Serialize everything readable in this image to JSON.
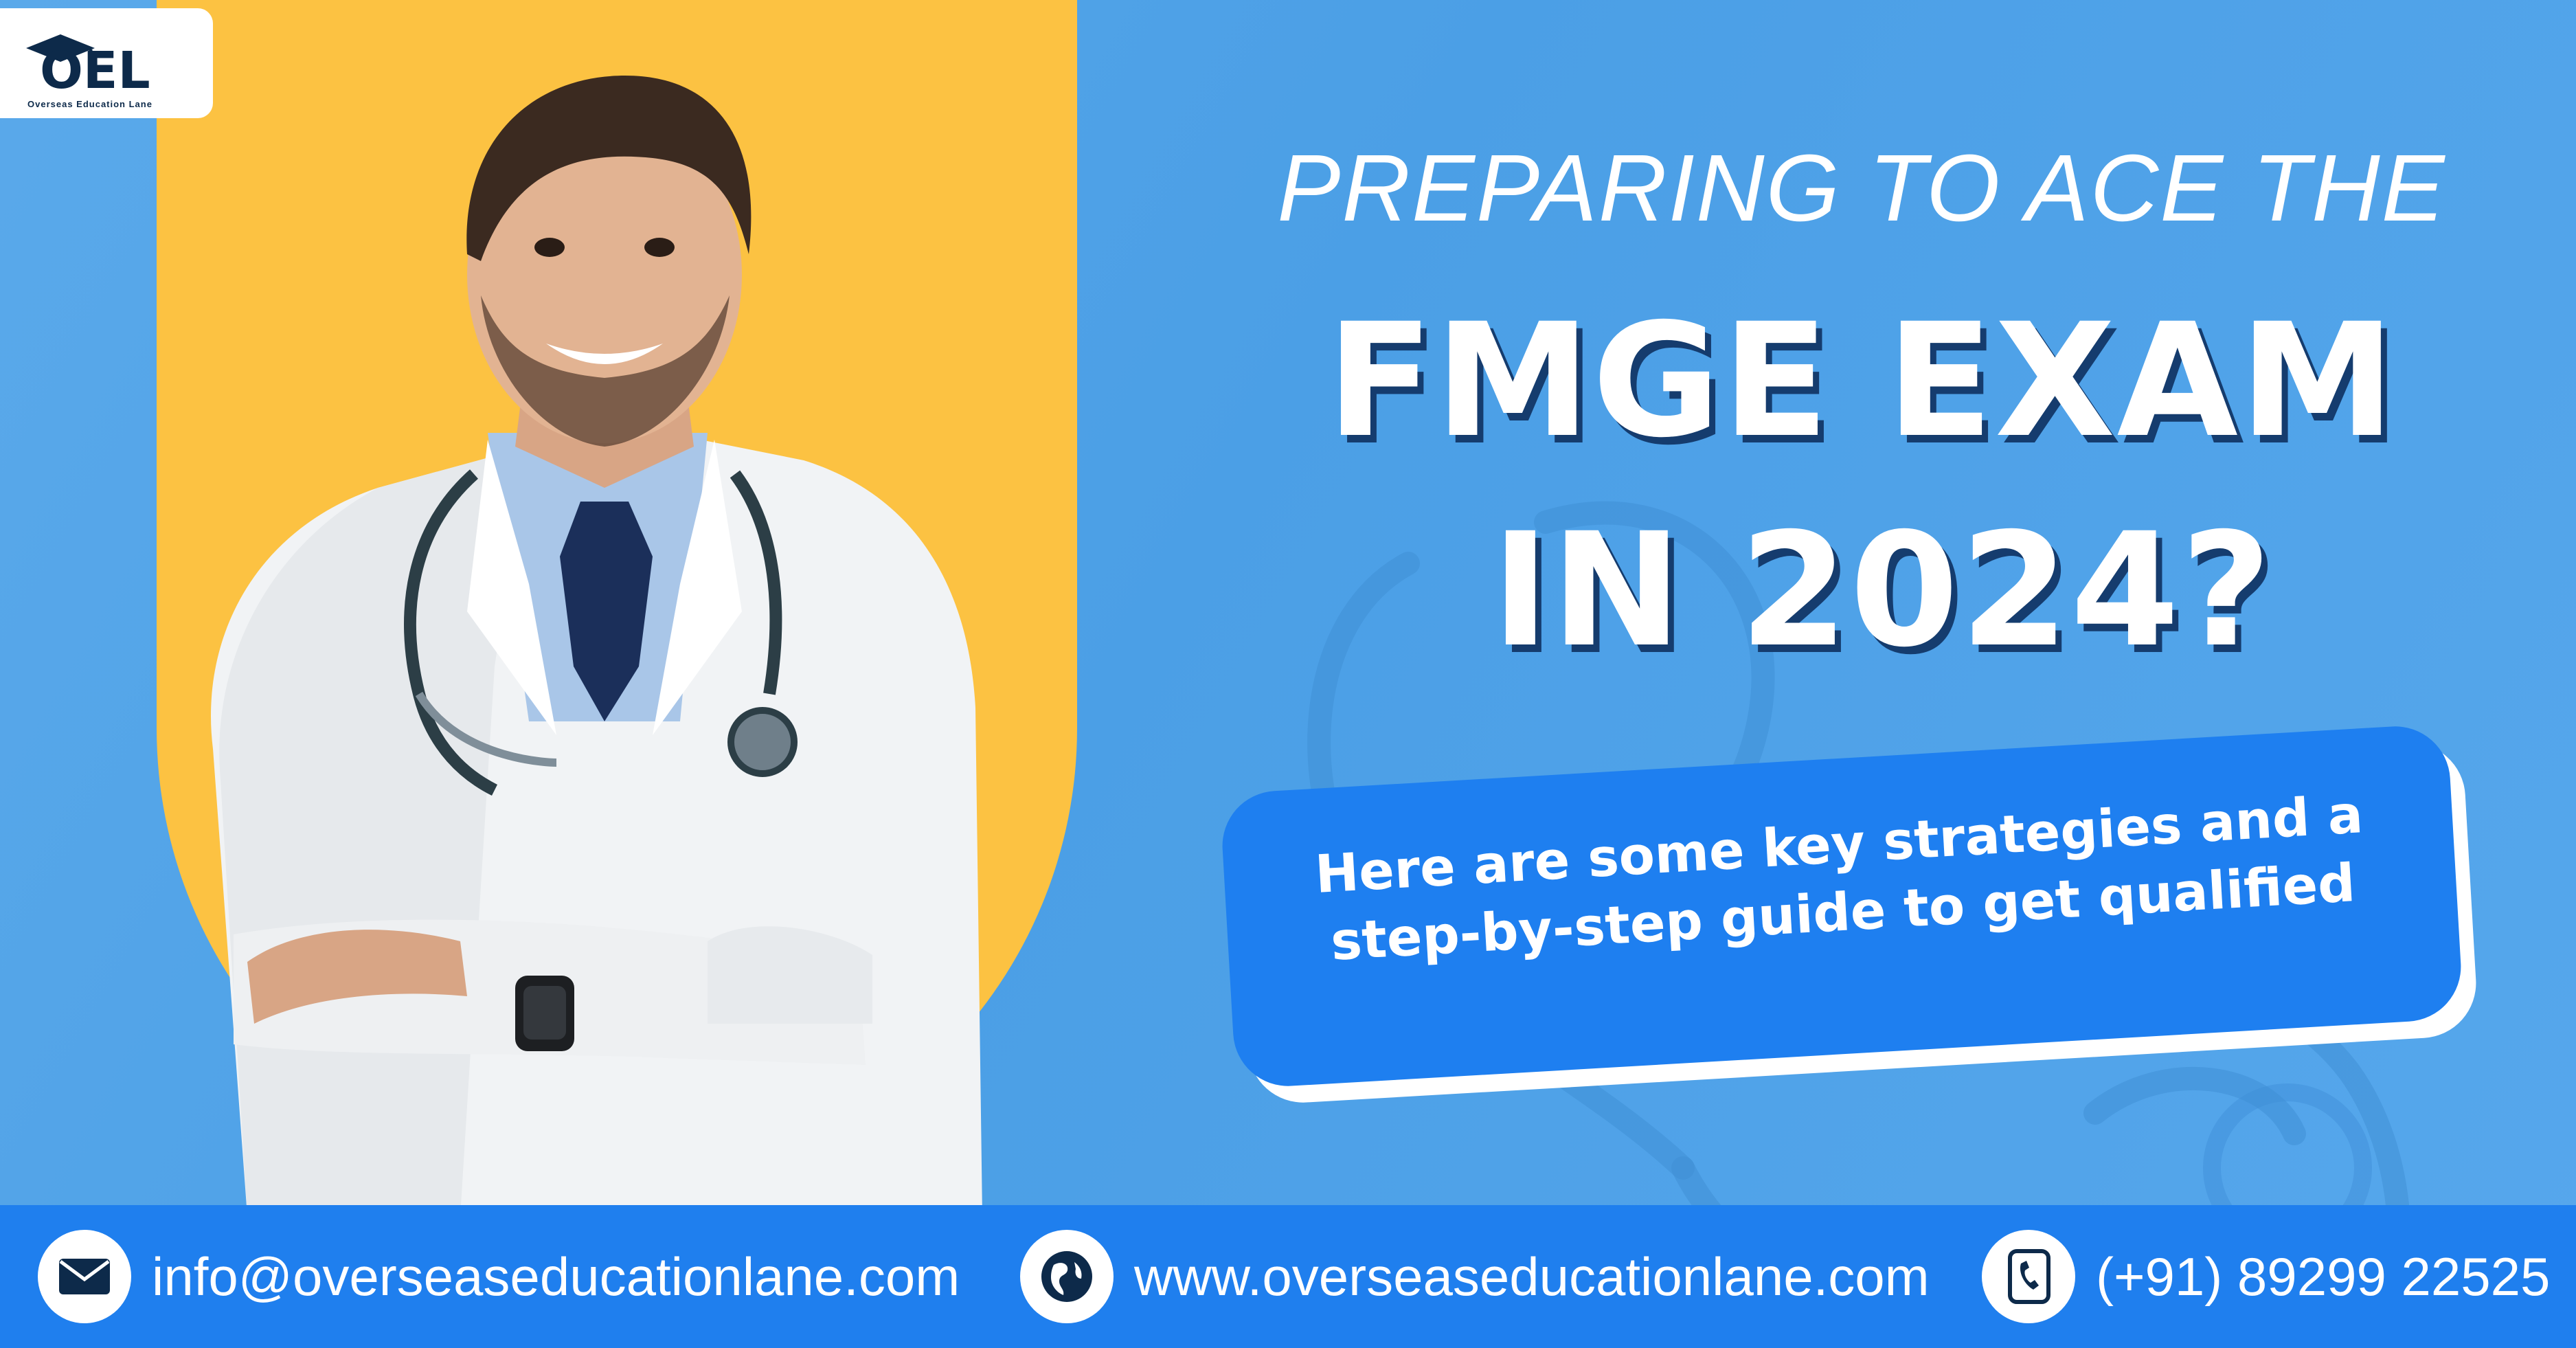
{
  "brand": {
    "logo_text": "OEL",
    "logo_tagline": "Overseas Education Lane"
  },
  "headline": {
    "line1": "PREPARING TO ACE THE",
    "line2": "FMGE EXAM",
    "line3": "IN 2024?"
  },
  "callout": {
    "line1": "Here are some key strategies and a",
    "line2": "step-by-step guide to get qualified"
  },
  "contact": {
    "email": "info@overseaseducationlane.com",
    "email_icon": "envelope-icon",
    "website": "www.overseaseducationlane.com",
    "website_icon": "globe-icon",
    "phone": "(+91) 89299 22525",
    "phone_icon": "phone-icon"
  },
  "colors": {
    "background": "#4b9fe6",
    "accent_yellow": "#fcc242",
    "pill_blue": "#1e7ff0",
    "footer_blue": "#1f7fee",
    "headline_shadow": "#153c6e",
    "text": "#ffffff"
  }
}
